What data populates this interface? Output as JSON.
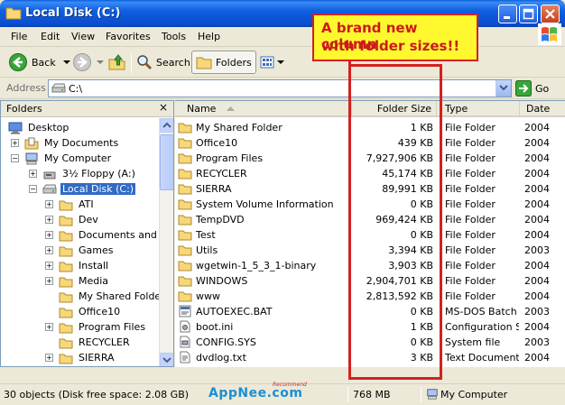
{
  "window": {
    "title": "Local Disk (C:)"
  },
  "menu": [
    "File",
    "Edit",
    "View",
    "Favorites",
    "Tools",
    "Help"
  ],
  "toolbar": {
    "back_label": "Back",
    "search_label": "Search",
    "folders_label": "Folders"
  },
  "address": {
    "label": "Address",
    "value": "C:\\",
    "go_label": "Go"
  },
  "folders_pane": {
    "title": "Folders",
    "close_glyph": "×",
    "items": [
      {
        "label": "Desktop",
        "icon": "desktop-icon"
      },
      {
        "label": "My Documents",
        "icon": "my-documents-icon"
      },
      {
        "label": "My Computer",
        "icon": "my-computer-icon"
      },
      {
        "label": "3½ Floppy (A:)",
        "icon": "floppy-icon"
      },
      {
        "label": "Local Disk (C:)",
        "icon": "drive-icon"
      },
      {
        "label": "ATI",
        "icon": "folder-icon"
      },
      {
        "label": "Dev",
        "icon": "folder-icon"
      },
      {
        "label": "Documents and Settings",
        "icon": "folder-icon"
      },
      {
        "label": "Games",
        "icon": "folder-icon"
      },
      {
        "label": "Install",
        "icon": "folder-icon"
      },
      {
        "label": "Media",
        "icon": "folder-icon"
      },
      {
        "label": "My Shared Folder",
        "icon": "folder-icon"
      },
      {
        "label": "Office10",
        "icon": "folder-icon"
      },
      {
        "label": "Program Files",
        "icon": "folder-icon"
      },
      {
        "label": "RECYCLER",
        "icon": "folder-icon"
      },
      {
        "label": "SIERRA",
        "icon": "folder-icon"
      }
    ]
  },
  "list": {
    "columns": [
      "Name",
      "Folder Size",
      "Type",
      "Date"
    ],
    "rows": [
      {
        "name": "My Shared Folder",
        "size": "1 KB",
        "type": "File Folder",
        "date": "2004",
        "icon": "folder-icon"
      },
      {
        "name": "Office10",
        "size": "439 KB",
        "type": "File Folder",
        "date": "2004",
        "icon": "folder-icon"
      },
      {
        "name": "Program Files",
        "size": "7,927,906 KB",
        "type": "File Folder",
        "date": "2004",
        "icon": "folder-icon"
      },
      {
        "name": "RECYCLER",
        "size": "45,174 KB",
        "type": "File Folder",
        "date": "2004",
        "icon": "folder-icon"
      },
      {
        "name": "SIERRA",
        "size": "89,991 KB",
        "type": "File Folder",
        "date": "2004",
        "icon": "folder-icon"
      },
      {
        "name": "System Volume Information",
        "size": "0 KB",
        "type": "File Folder",
        "date": "2004",
        "icon": "folder-icon"
      },
      {
        "name": "TempDVD",
        "size": "969,424 KB",
        "type": "File Folder",
        "date": "2004",
        "icon": "folder-icon"
      },
      {
        "name": "Test",
        "size": "0 KB",
        "type": "File Folder",
        "date": "2004",
        "icon": "folder-icon"
      },
      {
        "name": "Utils",
        "size": "3,394 KB",
        "type": "File Folder",
        "date": "2003",
        "icon": "folder-icon"
      },
      {
        "name": "wgetwin-1_5_3_1-binary",
        "size": "3,903 KB",
        "type": "File Folder",
        "date": "2004",
        "icon": "folder-icon"
      },
      {
        "name": "WINDOWS",
        "size": "2,904,701 KB",
        "type": "File Folder",
        "date": "2004",
        "icon": "folder-icon"
      },
      {
        "name": "www",
        "size": "2,813,592 KB",
        "type": "File Folder",
        "date": "2004",
        "icon": "folder-icon"
      },
      {
        "name": "AUTOEXEC.BAT",
        "size": "0 KB",
        "type": "MS-DOS Batch File",
        "date": "2003",
        "icon": "batch-file-icon"
      },
      {
        "name": "boot.ini",
        "size": "1 KB",
        "type": "Configuration Settings",
        "date": "2004",
        "icon": "ini-file-icon"
      },
      {
        "name": "CONFIG.SYS",
        "size": "0 KB",
        "type": "System file",
        "date": "2003",
        "icon": "system-file-icon"
      },
      {
        "name": "dvdlog.txt",
        "size": "3 KB",
        "type": "Text Document",
        "date": "2004",
        "icon": "text-file-icon"
      }
    ]
  },
  "status": {
    "objects": "30 objects (Disk free space: 2.08 GB)",
    "size": "768 MB",
    "zone": "My Computer"
  },
  "watermark": {
    "text": "AppNee.com",
    "small": "Recommend"
  },
  "annotation": {
    "line1": "A brand new column",
    "line2": "with folder sizes!!"
  },
  "colors": {
    "title_blue": "#0a4fd0",
    "selection": "#316ac5",
    "annotation_red": "#d42020",
    "annotation_yellow": "#fff82f"
  }
}
